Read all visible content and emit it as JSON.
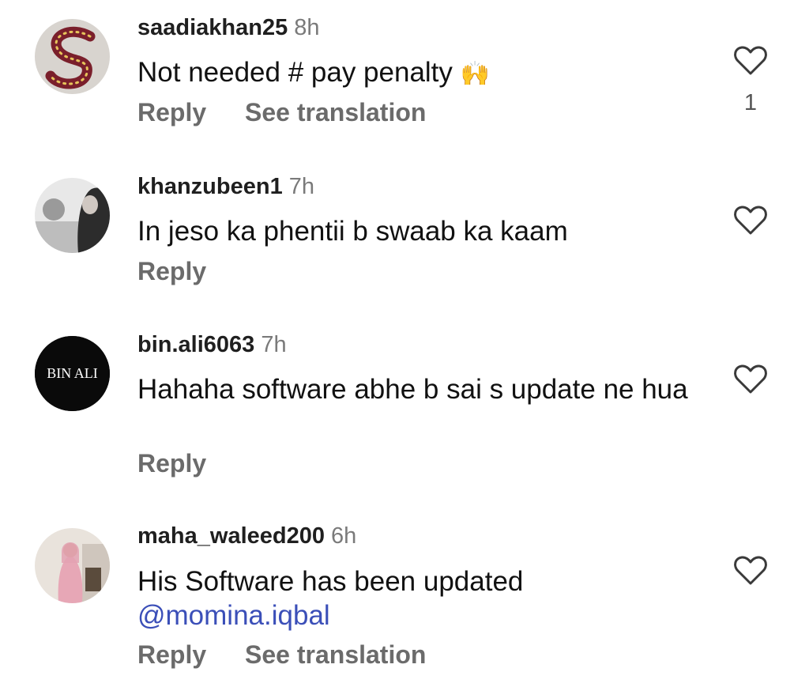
{
  "comments": [
    {
      "username": "saadiakhan25",
      "time": "8h",
      "text": "Not needed # pay penalty",
      "emoji": "🙌",
      "reply_label": "Reply",
      "translate_label": "See translation",
      "like_count": "1"
    },
    {
      "username": "khanzubeen1",
      "time": "7h",
      "text": "In jeso ka phentii b swaab ka kaam",
      "reply_label": "Reply"
    },
    {
      "username": "bin.ali6063",
      "time": "7h",
      "avatar_text": "BIN ALI",
      "text": "Hahaha software abhe b sai s update ne hua",
      "reply_label": "Reply"
    },
    {
      "username": "maha_waleed200",
      "time": "6h",
      "text": "His Software has been updated",
      "mention": "@momina.iqbal",
      "reply_label": "Reply",
      "translate_label": "See translation"
    }
  ],
  "icons": {
    "like": "heart-outline-icon"
  },
  "colors": {
    "mention": "#3b4fb8",
    "secondary_text": "#6b6b6b",
    "timestamp": "#7a7a7a"
  }
}
